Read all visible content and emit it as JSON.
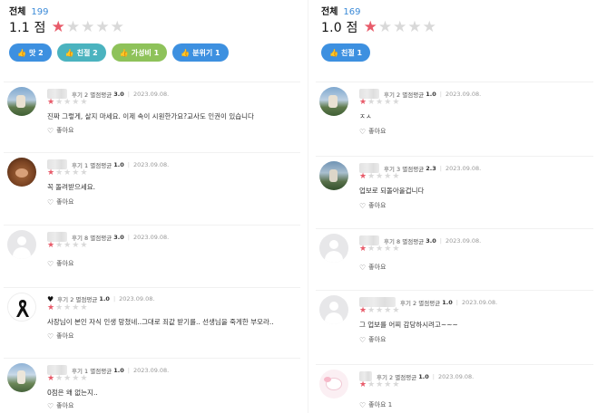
{
  "left": {
    "header": {
      "title": "전체",
      "count": "199"
    },
    "score": "1.1 점",
    "rating": 1,
    "chips": [
      {
        "label": "맛 2",
        "color": "#3d90e0"
      },
      {
        "label": "친절 2",
        "color": "#4bb3bf"
      },
      {
        "label": "가성비 1",
        "color": "#8ec25a"
      },
      {
        "label": "분위기 1",
        "color": "#3d90e0"
      }
    ],
    "reviews": [
      {
        "reviews": "후기 2",
        "avg_label": "별점평균",
        "avg": "3.0",
        "date": "2023.09.08.",
        "rating": 1,
        "text": "진짜 그렇게, 살지 마세요. 이제 속이 시원한가요?교사도 인권이 있습니다",
        "like": "좋아요"
      },
      {
        "reviews": "후기 1",
        "avg_label": "별점평균",
        "avg": "1.0",
        "date": "2023.09.08.",
        "rating": 1,
        "text": "꼭 돌려받으세요.",
        "like": "좋아요"
      },
      {
        "reviews": "후기 8",
        "avg_label": "별점평균",
        "avg": "3.0",
        "date": "2023.09.08.",
        "rating": 1,
        "text": "",
        "like": "좋아요"
      },
      {
        "reviews": "후기 2",
        "avg_label": "별점평균",
        "avg": "1.0",
        "date": "2023.09.08.",
        "rating": 1,
        "text": "사장님이 본인 자식 인생 망쳤네..그대로 죄값 받기를.. 선생님을 죽게한 부모라..",
        "like": "좋아요"
      },
      {
        "reviews": "후기 1",
        "avg_label": "별점평균",
        "avg": "1.0",
        "date": "2023.09.08.",
        "rating": 1,
        "text": "0점은 왜 없는지..",
        "like": "좋아요"
      }
    ]
  },
  "right": {
    "header": {
      "title": "전체",
      "count": "169"
    },
    "score": "1.0 점",
    "rating": 1,
    "chips": [
      {
        "label": "친절 1",
        "color": "#3d90e0"
      }
    ],
    "reviews": [
      {
        "reviews": "후기 2",
        "avg_label": "별점평균",
        "avg": "1.0",
        "date": "2023.09.08.",
        "rating": 1,
        "text": "ㅈㅅ",
        "like": "좋아요"
      },
      {
        "reviews": "후기 3",
        "avg_label": "별점평균",
        "avg": "2.3",
        "date": "2023.09.08.",
        "rating": 1,
        "text": "업보로 되돌아올겁니다",
        "like": "좋아요"
      },
      {
        "reviews": "후기 8",
        "avg_label": "별점평균",
        "avg": "3.0",
        "date": "2023.09.08.",
        "rating": 1,
        "text": "",
        "like": "좋아요"
      },
      {
        "reviews": "후기 2",
        "avg_label": "별점평균",
        "avg": "1.0",
        "date": "2023.09.08.",
        "rating": 1,
        "text": "그 업보를 어찌 감당하시려고~~~",
        "like": "좋아요"
      },
      {
        "reviews": "후기 2",
        "avg_label": "별점평균",
        "avg": "1.0",
        "date": "2023.09.08.",
        "rating": 1,
        "text": "",
        "like": "좋아요 1"
      }
    ]
  },
  "icons": {
    "star": "star-icon",
    "thumb": "thumbs-up-icon",
    "heart": "heart-icon",
    "ribbon": "black-ribbon-icon"
  },
  "colors": {
    "star_on": "#e85b6a",
    "star_off": "#d9d9d9",
    "count": "#3b8ad8"
  }
}
